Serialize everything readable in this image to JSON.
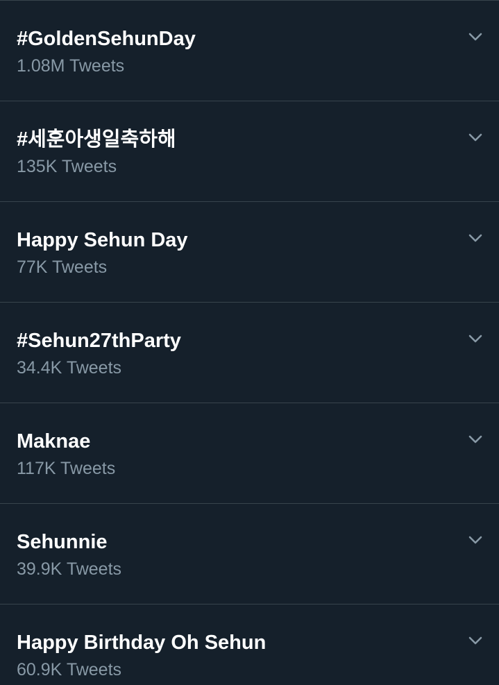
{
  "trends": [
    {
      "name": "#GoldenSehunDay",
      "count": "1.08M Tweets",
      "menu_icon": "chevron-down-icon"
    },
    {
      "name": "#세훈아생일축하해",
      "count": "135K Tweets",
      "menu_icon": "chevron-down-icon"
    },
    {
      "name": "Happy Sehun Day",
      "count": "77K Tweets",
      "menu_icon": "chevron-down-icon"
    },
    {
      "name": "#Sehun27thParty",
      "count": "34.4K Tweets",
      "menu_icon": "chevron-down-icon"
    },
    {
      "name": "Maknae",
      "count": "117K Tweets",
      "menu_icon": "chevron-down-icon"
    },
    {
      "name": "Sehunnie",
      "count": "39.9K Tweets",
      "menu_icon": "chevron-down-icon"
    },
    {
      "name": "Happy Birthday Oh Sehun",
      "count": "60.9K Tweets",
      "menu_icon": "chevron-down-icon"
    }
  ],
  "colors": {
    "background": "#15202b",
    "divider": "#38444d",
    "primary_text": "#ffffff",
    "secondary_text": "#8899a6",
    "icon": "#8899a6"
  }
}
